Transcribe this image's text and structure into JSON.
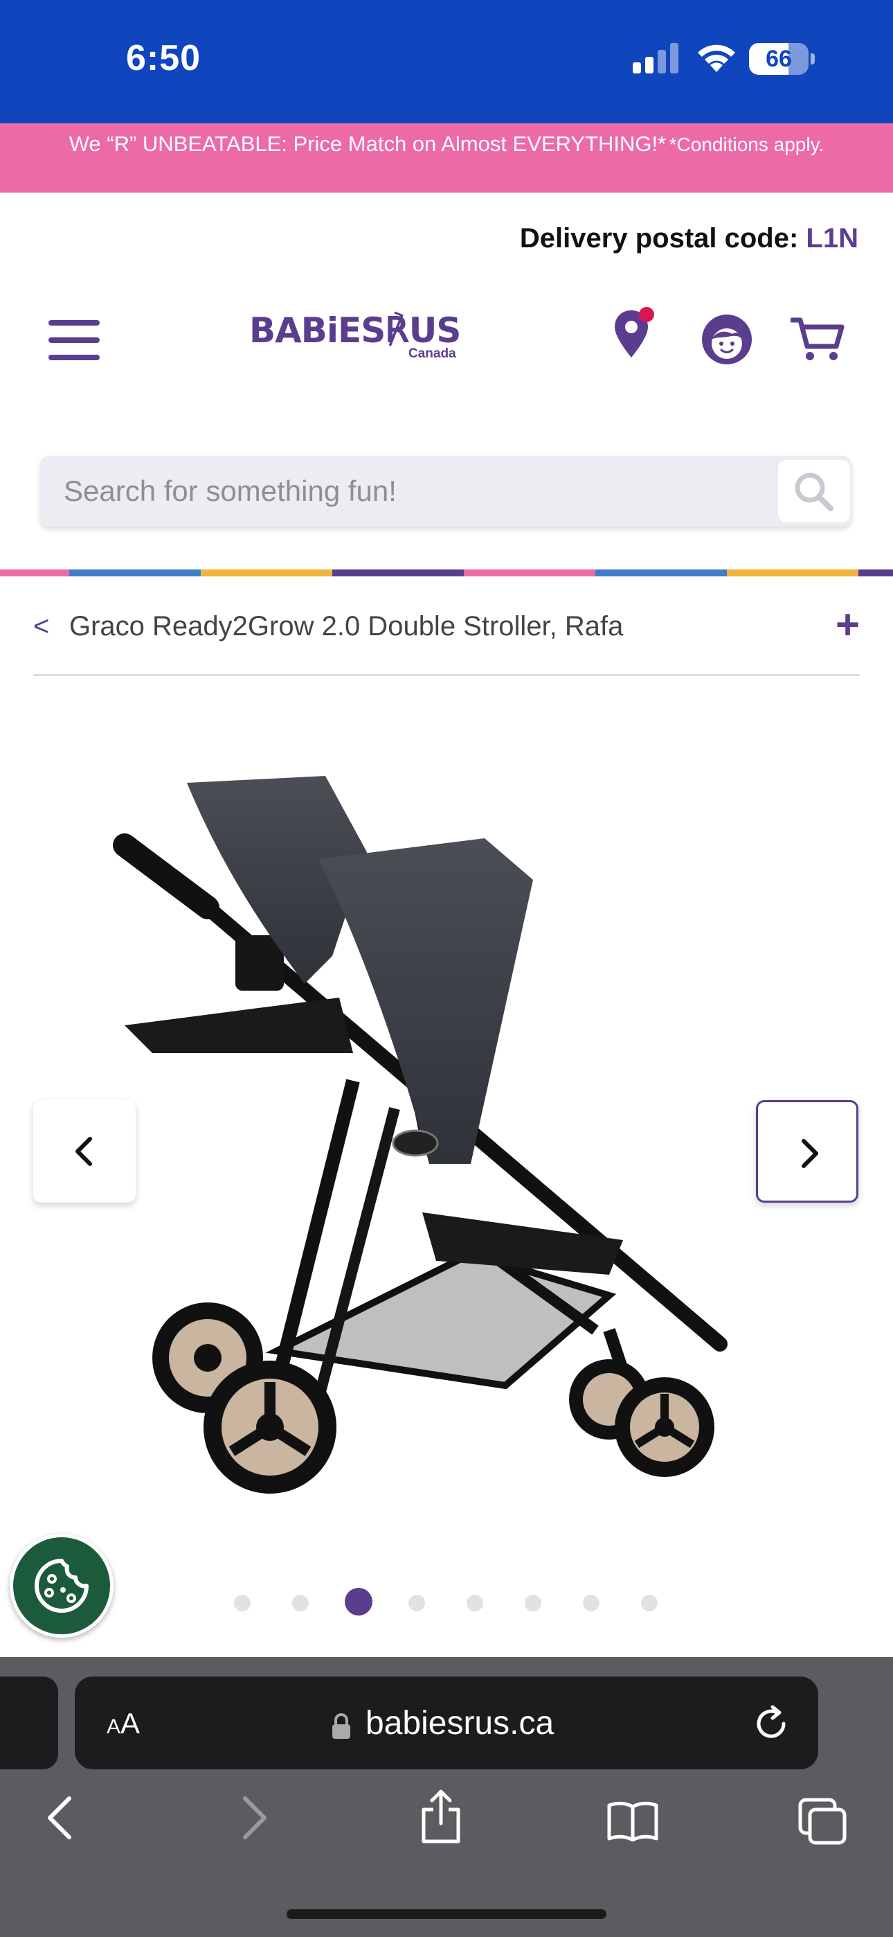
{
  "status_bar": {
    "time": "6:50",
    "battery": "66",
    "battery_level": 0.66,
    "bg_color": "#0f46be"
  },
  "promo": {
    "main": "We “R” UNBEATABLE: Price Match on Almost EVERYTHING!*",
    "conditions": "*Conditions apply.",
    "bg_color": "#ec6ba7"
  },
  "delivery": {
    "label": "Delivery postal code:",
    "code": "L1N"
  },
  "header": {
    "logo_text": "BABiES℟US",
    "logo_sub": "Canada",
    "icons": [
      "menu-icon",
      "store-locator-icon",
      "account-icon",
      "cart-icon"
    ]
  },
  "search": {
    "placeholder": "Search for something fun!"
  },
  "rainbow_colors": [
    "#ec6ba7",
    "#3d7fc8",
    "#f3b43c",
    "#5b3d8f",
    "#ec6ba7",
    "#3d7fc8",
    "#f3b43c",
    "#5b3d8f"
  ],
  "breadcrumb": {
    "back": "<",
    "title": "Graco Ready2Grow 2.0 Double Stroller, Rafa",
    "expand": "+"
  },
  "carousel": {
    "total": 8,
    "active_index": 2,
    "accent_color": "#5b3d8f"
  },
  "safari": {
    "text_size": {
      "small": "A",
      "big": "A"
    },
    "url": "babiesrus.ca"
  }
}
